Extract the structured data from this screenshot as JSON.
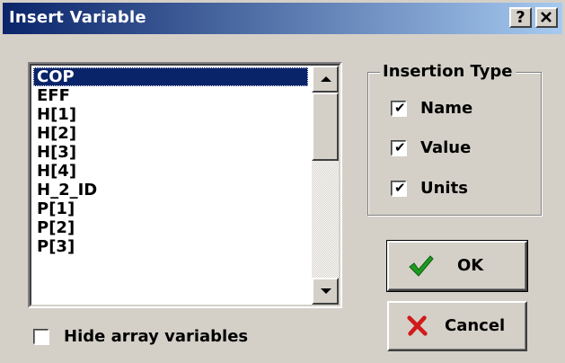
{
  "window": {
    "title": "Insert Variable",
    "help_glyph": "?",
    "close_glyph": "✕"
  },
  "variable_list": {
    "selected_index": 0,
    "items": [
      "COP",
      "EFF",
      "H[1]",
      "H[2]",
      "H[3]",
      "H[4]",
      "H_2_ID",
      "P[1]",
      "P[2]",
      "P[3]"
    ]
  },
  "insertion_type": {
    "legend": "Insertion Type",
    "options": [
      {
        "label": "Name",
        "checked": true
      },
      {
        "label": "Value",
        "checked": true
      },
      {
        "label": "Units",
        "checked": true
      }
    ]
  },
  "hide_array": {
    "label": "Hide array variables",
    "checked": false
  },
  "buttons": {
    "ok_label": "OK",
    "ok_icon": "green-checkmark-icon",
    "cancel_label": "Cancel",
    "cancel_icon": "red-x-icon"
  },
  "colors": {
    "title_start": "#0a246a",
    "title_end": "#a6caf0",
    "selection": "#0a246a",
    "face": "#d4d0c8",
    "ok_icon": "#1f9a1f",
    "cancel_icon": "#d11a1a"
  }
}
